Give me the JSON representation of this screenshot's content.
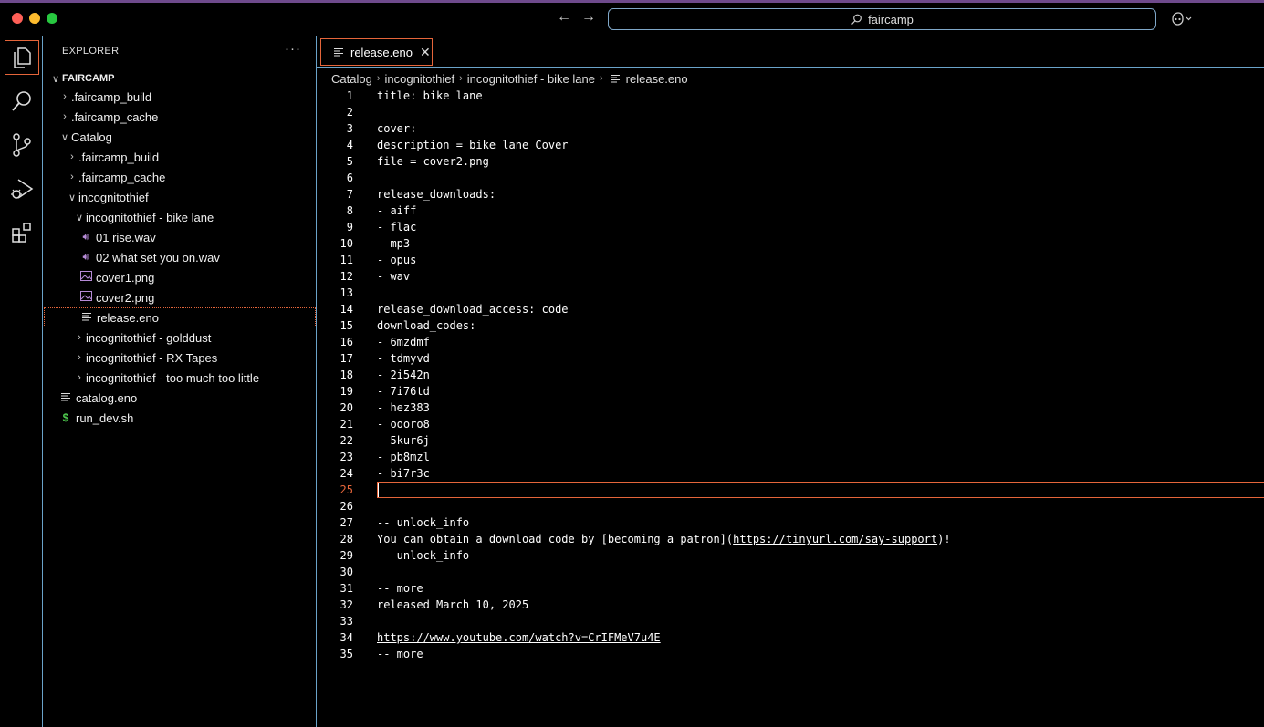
{
  "window": {
    "search_text": "faircamp",
    "colors": {
      "close": "#fe5f57",
      "minimize": "#febc2e",
      "zoom": "#28c840",
      "accent": "#e5653a",
      "border": "#6aa3c9"
    }
  },
  "sidebar": {
    "title": "EXPLORER",
    "root": "FAIRCAMP",
    "items": [
      {
        "label": ".faircamp_build",
        "kind": "folder",
        "expanded": false
      },
      {
        "label": ".faircamp_cache",
        "kind": "folder",
        "expanded": false
      },
      {
        "label": "Catalog",
        "kind": "folder",
        "expanded": true
      },
      {
        "label": ".faircamp_build",
        "kind": "folder",
        "expanded": false
      },
      {
        "label": ".faircamp_cache",
        "kind": "folder",
        "expanded": false
      },
      {
        "label": "incognitothief",
        "kind": "folder",
        "expanded": true
      },
      {
        "label": "incognitothief - bike lane",
        "kind": "folder",
        "expanded": true
      },
      {
        "label": "01 rise.wav",
        "kind": "audio",
        "icon": "speaker-icon"
      },
      {
        "label": "02 what set you on.wav",
        "kind": "audio",
        "icon": "speaker-icon"
      },
      {
        "label": "cover1.png",
        "kind": "image",
        "icon": "image-icon"
      },
      {
        "label": "cover2.png",
        "kind": "image",
        "icon": "image-icon"
      },
      {
        "label": "release.eno",
        "kind": "text",
        "icon": "lines-icon",
        "selected": true
      },
      {
        "label": "incognitothief - golddust",
        "kind": "folder",
        "expanded": false
      },
      {
        "label": "incognitothief - RX Tapes",
        "kind": "folder",
        "expanded": false
      },
      {
        "label": "incognitothief - too much too little",
        "kind": "folder",
        "expanded": false
      },
      {
        "label": "catalog.eno",
        "kind": "text",
        "icon": "lines-icon"
      },
      {
        "label": "run_dev.sh",
        "kind": "shell",
        "icon": "dollar-icon"
      }
    ]
  },
  "editor": {
    "tab_label": "release.eno",
    "breadcrumb": [
      "Catalog",
      "incognitothief",
      "incognitothief - bike lane",
      "release.eno"
    ],
    "current_line": 25,
    "lines": [
      "title: bike lane",
      "",
      "cover:",
      "description = bike lane Cover",
      "file = cover2.png",
      "",
      "release_downloads:",
      "- aiff",
      "- flac",
      "- mp3",
      "- opus",
      "- wav",
      "",
      "release_download_access: code",
      "download_codes:",
      "- 6mzdmf",
      "- tdmyvd",
      "- 2i542n",
      "- 7i76td",
      "- hez383",
      "- oooro8",
      "- 5kur6j",
      "- pb8mzl",
      "- bi7r3c",
      "",
      "",
      "-- unlock_info",
      "You can obtain a download code by [becoming a patron](https://tinyurl.com/say-support)!",
      "-- unlock_info",
      "",
      "-- more",
      "released March 10, 2025",
      "",
      "https://www.youtube.com/watch?v=CrIFMeV7u4E",
      "-- more"
    ],
    "line_numbers": [
      "1",
      "2",
      "3",
      "4",
      "5",
      "6",
      "7",
      "8",
      "9",
      "10",
      "11",
      "12",
      "13",
      "14",
      "15",
      "16",
      "17",
      "18",
      "19",
      "20",
      "21",
      "22",
      "23",
      "24",
      "25",
      "26",
      "27",
      "28",
      "29",
      "30",
      "31",
      "32",
      "33",
      "34",
      "35"
    ],
    "line28_parts": [
      "You can obtain a download code by [becoming a patron](",
      "https://tinyurl.com/say-support",
      ")!"
    ]
  }
}
